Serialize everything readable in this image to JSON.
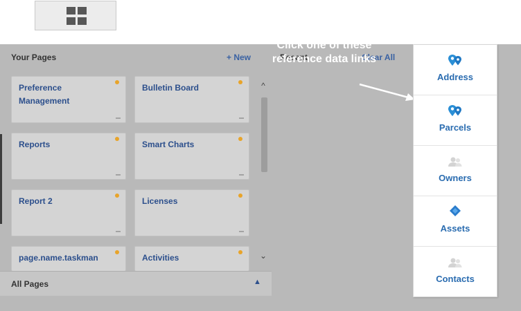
{
  "toolbar": {
    "grid_icon": "grid-icon"
  },
  "your_pages": {
    "title": "Your Pages",
    "new_label": "+ New",
    "tiles": [
      {
        "label": "Preference Management"
      },
      {
        "label": "Bulletin Board"
      },
      {
        "label": "Reports"
      },
      {
        "label": "Smart Charts"
      },
      {
        "label": "Report 2"
      },
      {
        "label": "Licenses"
      },
      {
        "label": "page.name.taskman"
      },
      {
        "label": "Activities"
      }
    ]
  },
  "recent": {
    "title": "Recent",
    "clear_label": "Clear All"
  },
  "all_pages": {
    "label": "All Pages"
  },
  "callout": {
    "text": "Click one of these reference data links"
  },
  "reference_menu": {
    "items": [
      {
        "label": "Address",
        "icon": "map-pin-icon"
      },
      {
        "label": "Parcels",
        "icon": "map-pin-icon"
      },
      {
        "label": "Owners",
        "icon": "people-icon"
      },
      {
        "label": "Assets",
        "icon": "diamond-icon"
      },
      {
        "label": "Contacts",
        "icon": "people-icon"
      }
    ]
  },
  "colors": {
    "link": "#2a6cb0",
    "star": "#e8a42a",
    "overlay": "#b9b9b9"
  }
}
